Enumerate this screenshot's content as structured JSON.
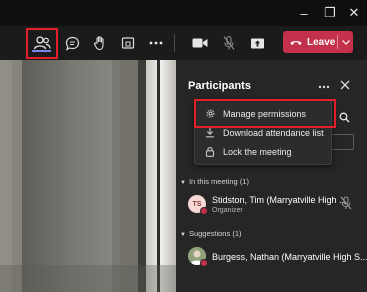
{
  "window": {
    "controls": {
      "minimize": "–",
      "restore": "❐",
      "close": "✕"
    }
  },
  "toolbar": {
    "leave_label": "Leave",
    "leave_color": "#c4314b",
    "highlight_color": "#e3202a"
  },
  "panel": {
    "title": "Participants",
    "menu": {
      "items": [
        {
          "label": "Manage permissions",
          "icon": "gear-icon"
        },
        {
          "label": "Download attendance list",
          "icon": "download-icon"
        },
        {
          "label": "Lock the meeting",
          "icon": "lock-icon"
        }
      ]
    },
    "in_meeting": {
      "header": "In this meeting (1)",
      "participants": [
        {
          "initials": "TS",
          "name": "Stidston, Tim (Marryatville High ...",
          "role": "Organizer"
        }
      ]
    },
    "suggestions": {
      "header": "Suggestions (1)",
      "participants": [
        {
          "name": "Burgess, Nathan (Marryatville High S..."
        }
      ]
    }
  }
}
